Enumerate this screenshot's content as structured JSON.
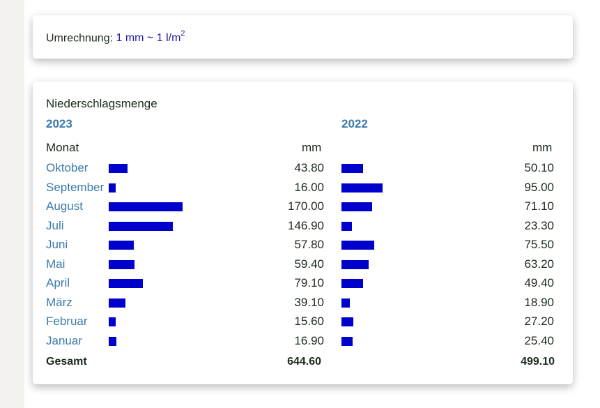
{
  "conversion": {
    "label": "Umrechnung:",
    "value": "1 mm ~ 1 l/m",
    "sup": "2"
  },
  "chart_data": {
    "type": "bar",
    "title": "Niederschlagsmenge",
    "header_label": "Monat",
    "unit": "mm",
    "total_label": "Gesamt",
    "categories": [
      "Oktober",
      "September",
      "August",
      "Juli",
      "Juni",
      "Mai",
      "April",
      "März",
      "Februar",
      "Januar"
    ],
    "series": [
      {
        "name": "2023",
        "values": [
          43.8,
          16.0,
          170.0,
          146.9,
          57.8,
          59.4,
          79.1,
          39.1,
          15.6,
          16.9
        ],
        "labels": [
          "43.80",
          "16.00",
          "170.00",
          "146.90",
          "57.80",
          "59.40",
          "79.10",
          "39.10",
          "15.60",
          "16.90"
        ],
        "total": "644.60"
      },
      {
        "name": "2022",
        "values": [
          50.1,
          95.0,
          71.1,
          23.3,
          75.5,
          63.2,
          49.4,
          18.9,
          27.2,
          25.4
        ],
        "labels": [
          "50.10",
          "95.00",
          "71.10",
          "23.30",
          "75.50",
          "63.20",
          "49.40",
          "18.90",
          "27.20",
          "25.40"
        ],
        "total": "499.10"
      }
    ],
    "bar_color": "#0000cc"
  }
}
